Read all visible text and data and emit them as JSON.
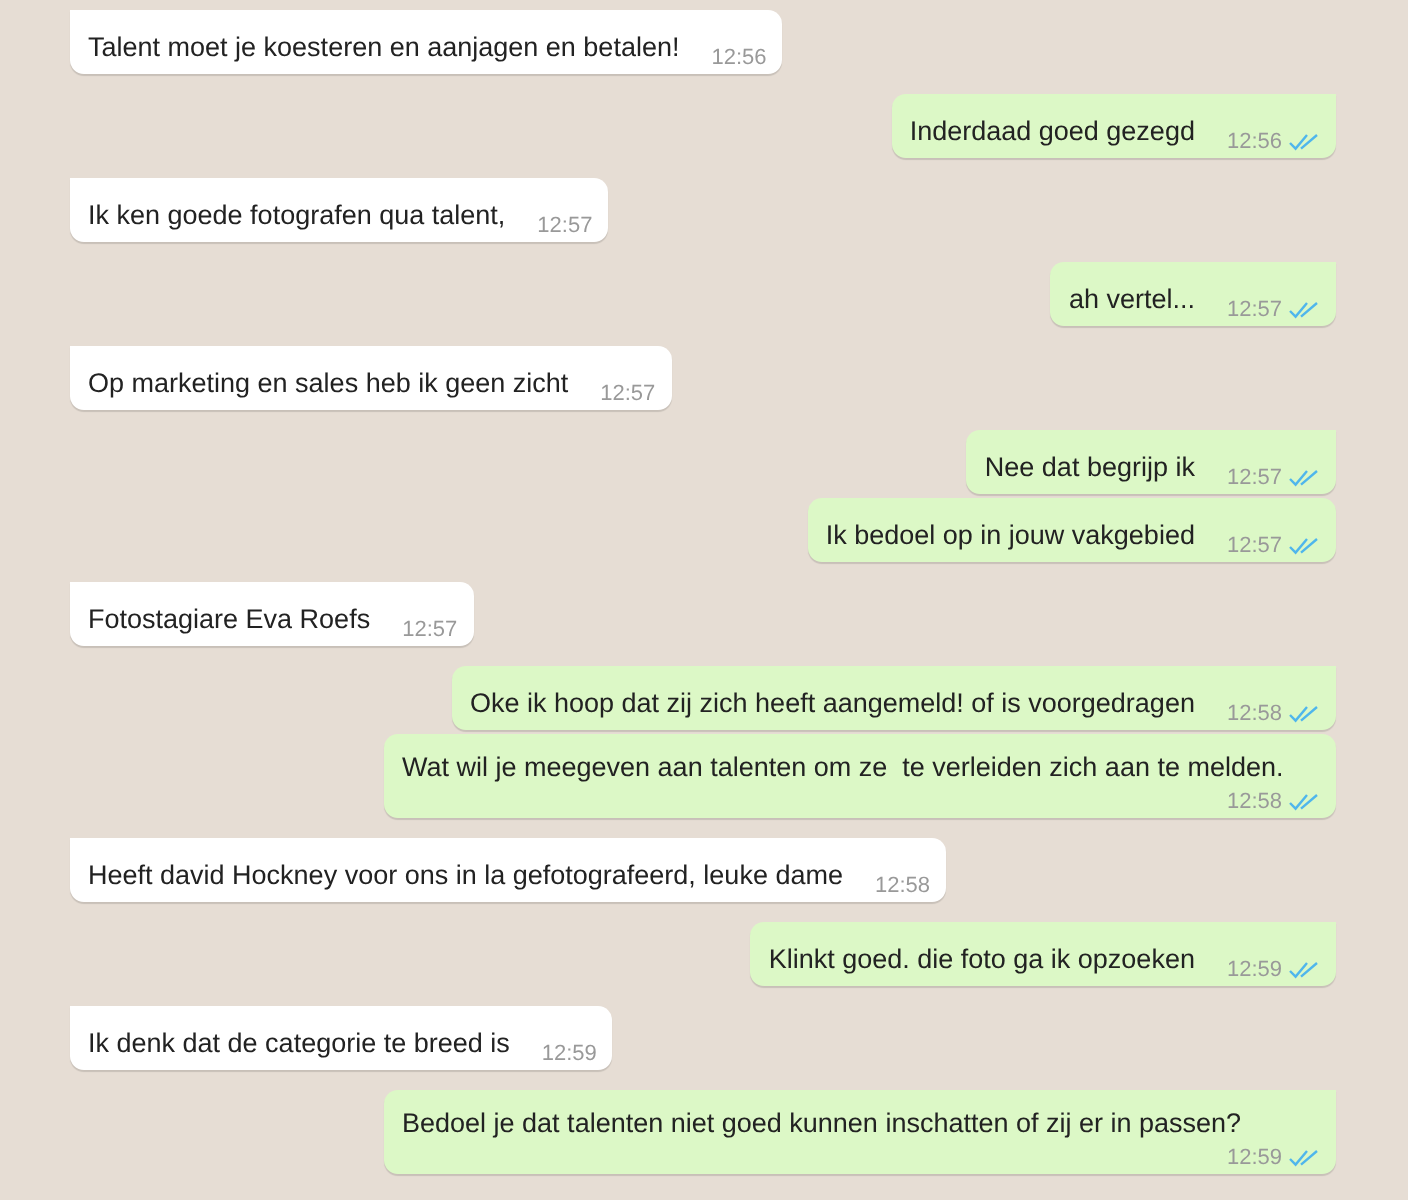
{
  "messages": [
    {
      "kind": "incoming",
      "first": true,
      "text": "Talent moet je koesteren en aanjagen en betalen!",
      "time": "12:56"
    },
    {
      "kind": "outgoing",
      "first": true,
      "text": "Inderdaad goed gezegd",
      "time": "12:56",
      "read": true
    },
    {
      "kind": "incoming",
      "first": true,
      "text": "Ik ken goede fotografen qua talent,",
      "time": "12:57"
    },
    {
      "kind": "outgoing",
      "first": true,
      "text": "ah vertel...",
      "time": "12:57",
      "read": true
    },
    {
      "kind": "incoming",
      "first": true,
      "text": "Op marketing en sales heb ik geen zicht",
      "time": "12:57"
    },
    {
      "kind": "outgoing",
      "first": true,
      "text": "Nee dat begrijp ik",
      "time": "12:57",
      "read": true
    },
    {
      "kind": "outgoing",
      "first": false,
      "text": "Ik bedoel op in jouw vakgebied",
      "time": "12:57",
      "read": true
    },
    {
      "kind": "incoming",
      "first": true,
      "text": "Fotostagiare Eva Roefs",
      "time": "12:57"
    },
    {
      "kind": "outgoing",
      "first": true,
      "text": "Oke ik hoop dat zij zich heeft aangemeld! of is voorgedragen",
      "time": "12:58",
      "read": true
    },
    {
      "kind": "outgoing",
      "first": false,
      "text": "Wat wil je meegeven aan talenten om ze  te verleiden zich aan te melden.",
      "time": "12:58",
      "read": true
    },
    {
      "kind": "incoming",
      "first": true,
      "text": "Heeft david Hockney voor ons in la gefotografeerd, leuke dame",
      "time": "12:58"
    },
    {
      "kind": "outgoing",
      "first": true,
      "text": "Klinkt goed. die foto ga ik opzoeken",
      "time": "12:59",
      "read": true
    },
    {
      "kind": "incoming",
      "first": true,
      "text": "Ik denk dat de categorie te breed is",
      "time": "12:59"
    },
    {
      "kind": "outgoing",
      "first": true,
      "text": "Bedoel je dat talenten niet goed kunnen inschatten of zij er in passen?",
      "time": "12:59",
      "read": true
    }
  ]
}
